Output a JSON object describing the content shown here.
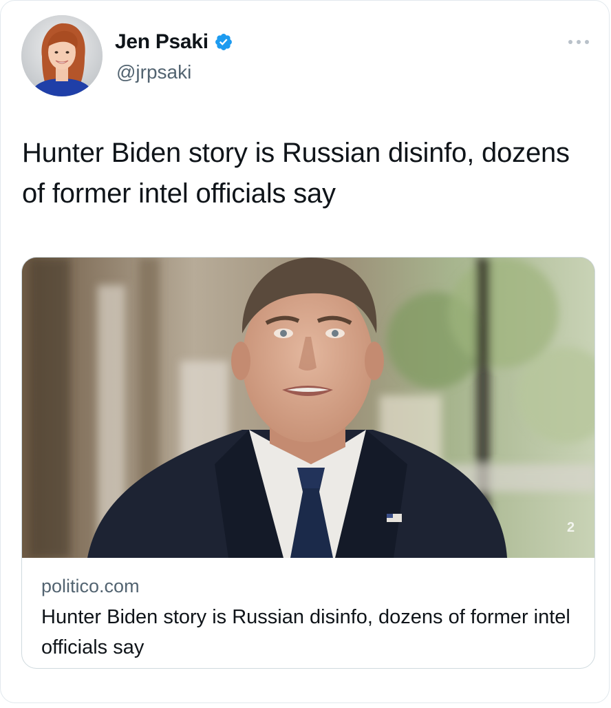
{
  "tweet": {
    "author": {
      "display_name": "Jen Psaki",
      "handle": "@jrpsaki",
      "verified": true,
      "avatar_icon": "profile-photo"
    },
    "text": "Hunter Biden story is Russian disinfo, dozens of former intel officials say",
    "more_icon": "more-horizontal-icon"
  },
  "link_card": {
    "domain": "politico.com",
    "title": "Hunter Biden story is Russian disinfo, dozens of former intel officials say",
    "image_icon": "article-thumbnail"
  },
  "colors": {
    "text_primary": "#0f1419",
    "text_secondary": "#536471",
    "verified_blue": "#1d9bf0",
    "border": "#cfd9de"
  }
}
